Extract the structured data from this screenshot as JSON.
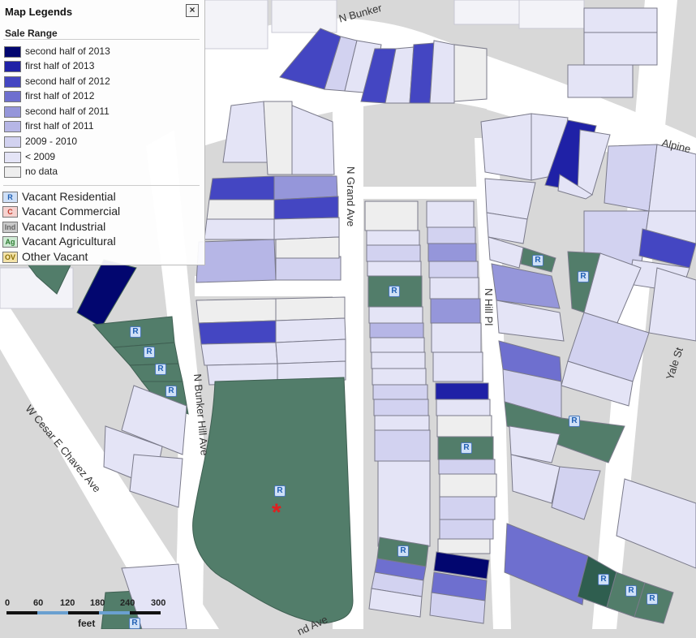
{
  "legend": {
    "title": "Map Legends",
    "close_label": "×",
    "subtitle": "Sale Range",
    "sale_ranges": [
      {
        "label": "second half of 2013",
        "color": "#02066f"
      },
      {
        "label": "first half of 2013",
        "color": "#1f21a6"
      },
      {
        "label": "second half of 2012",
        "color": "#4446c2"
      },
      {
        "label": "first half of 2012",
        "color": "#6e6fcf"
      },
      {
        "label": "second half of 2011",
        "color": "#9596da"
      },
      {
        "label": "first half of 2011",
        "color": "#b6b6e6"
      },
      {
        "label": "2009 - 2010",
        "color": "#d2d2f0"
      },
      {
        "label": "< 2009",
        "color": "#e4e4f6"
      },
      {
        "label": "no data",
        "color": "#eeeeee"
      }
    ],
    "vacant_types": [
      {
        "code": "R",
        "label": "Vacant Residential",
        "bg": "#cfe0f7",
        "fg": "#1f5fb3"
      },
      {
        "code": "C",
        "label": "Vacant Commercial",
        "bg": "#f6d2cf",
        "fg": "#c0392b"
      },
      {
        "code": "Ind",
        "label": "Vacant Industrial",
        "bg": "#c9c9c9",
        "fg": "#666666"
      },
      {
        "code": "Ag",
        "label": "Vacant Agricultural",
        "bg": "#cfead4",
        "fg": "#2e7d32"
      },
      {
        "code": "OV",
        "label": "Other Vacant",
        "bg": "#f4e3a8",
        "fg": "#8a6d00"
      }
    ]
  },
  "streets": {
    "n_bunker_top": "N Bunker",
    "alpine": "Alpine",
    "n_grand_ave": "N Grand Ave",
    "n_hill_pl": "N Hill Pl",
    "yale_st": "Yale St",
    "n_bunker_hill_ave": "N Bunker Hill Ave",
    "w_cesar_chavez": "W Cesar E Chavez Ave",
    "grand_ave_bottom": "nd Ave"
  },
  "vacant_marker": "R",
  "scale": {
    "ticks": [
      "0",
      "60",
      "120",
      "180",
      "240",
      "300"
    ],
    "unit": "feet"
  },
  "colors": {
    "street": "#ffffff",
    "block": "#d8d8d8",
    "vacant_green": "#527d6a",
    "parcel_outline": "#7a7a8a",
    "selected_marker": "#e02020"
  }
}
